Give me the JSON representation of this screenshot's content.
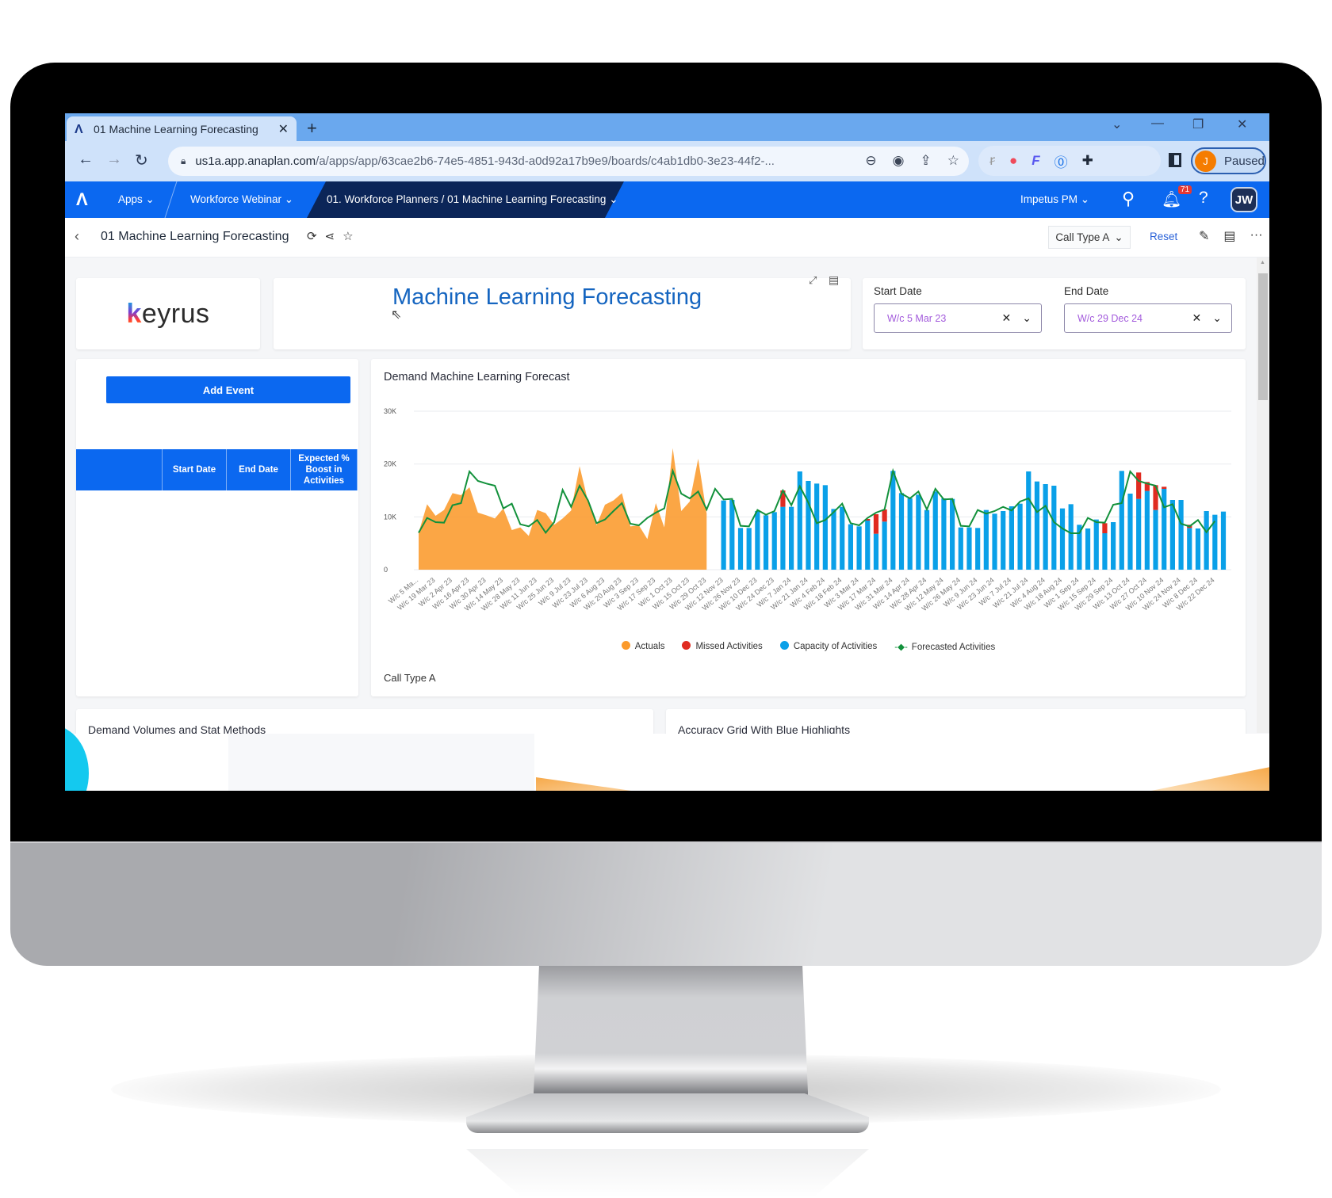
{
  "browser": {
    "tab_title": "01 Machine Learning Forecasting",
    "url_host": "us1a.app.anaplan.com",
    "url_path": "/a/apps/app/63cae2b6-74e5-4851-943d-a0d92a17b9e9/boards/c4ab1db0-3e23-44f2-...",
    "profile_initial": "J",
    "profile_status": "Paused"
  },
  "appbar": {
    "apps_label": "Apps",
    "workspace_label": "Workforce Webinar",
    "page_breadcrumb": "01. Workforce Planners / 01 Machine Learning Forecasting",
    "workspace_model": "Impetus PM",
    "notification_count": "71",
    "user_initials": "JW"
  },
  "pagebar": {
    "title": "01 Machine Learning Forecasting",
    "context_selector": "Call Type A",
    "reset_label": "Reset"
  },
  "header_card": {
    "logo_text": "keyrus",
    "logo_first_letter": "k",
    "logo_rest": "eyrus",
    "title": "Machine Learning Forecasting"
  },
  "filters": {
    "start_label": "Start Date",
    "start_value": "W/c 5 Mar 23",
    "end_label": "End Date",
    "end_value": "W/c 29 Dec 24"
  },
  "events": {
    "add_button": "Add Event",
    "columns": [
      "",
      "Start Date",
      "End Date",
      "Expected % Boost in Activities"
    ]
  },
  "sections": {
    "demand_volumes": "Demand Volumes and Stat Methods",
    "accuracy_grid": "Accuracy Grid With Blue Highlights"
  },
  "colors": {
    "actuals": "#fb9a2b",
    "missed": "#e02b20",
    "capacity": "#0aa0e8",
    "forecast": "#12913b",
    "brand": "#0b68f0"
  },
  "chart_data": {
    "type": "bar",
    "title": "Demand Machine Learning Forecast",
    "subtitle": "Call Type A",
    "xlabel": "",
    "ylabel": "",
    "ylim": [
      0,
      30000
    ],
    "yticks": [
      "0",
      "10K",
      "20K",
      "30K"
    ],
    "grid": true,
    "legend_position": "bottom",
    "legend": [
      "Actuals",
      "Missed Activities",
      "Capacity of Activities",
      "Forecasted Activities"
    ],
    "week_count": 96,
    "x_tick_labels": [
      "W/c 5 Ma...",
      "W/c 19 Mar 23",
      "W/c 2 Apr 23",
      "W/c 16 Apr 23",
      "W/c 30 Apr 23",
      "W/c 14 May 23",
      "W/c 28 May 23",
      "W/c 11 Jun 23",
      "W/c 25 Jun 23",
      "W/c 9 Jul 23",
      "W/c 23 Jul 23",
      "W/c 6 Aug 23",
      "W/c 20 Aug 23",
      "W/c 3 Sep 23",
      "W/c 17 Sep 23",
      "W/c 1 Oct 23",
      "W/c 15 Oct 23",
      "W/c 29 Oct 23",
      "W/c 12 Nov 23",
      "W/c 26 Nov 23",
      "W/c 10 Dec 23",
      "W/c 24 Dec 23",
      "W/c 7 Jan 24",
      "W/c 21 Jan 24",
      "W/c 4 Feb 24",
      "W/c 18 Feb 24",
      "W/c 3 Mar 24",
      "W/c 17 Mar 24",
      "W/c 31 Mar 24",
      "W/c 14 Apr 24",
      "W/c 28 Apr 24",
      "W/c 12 May 24",
      "W/c 26 May 24",
      "W/c 9 Jun 24",
      "W/c 23 Jun 24",
      "W/c 7 Jul 24",
      "W/c 21 Jul 24",
      "W/c 4 Aug 24",
      "W/c 18 Aug 24",
      "W/c 1 Sep 24",
      "W/c 15 Sep 24",
      "W/c 29 Sep 24",
      "W/c 13 Oct 24",
      "W/c 27 Oct 24",
      "W/c 10 Nov 24",
      "W/c 24 Nov 24",
      "W/c 8 Dec 24",
      "W/c 22 Dec 24"
    ],
    "series": [
      {
        "name": "Actuals",
        "kind": "area",
        "start_index": 0,
        "values": [
          7000,
          12400,
          10200,
          11300,
          14500,
          14100,
          15600,
          10800,
          10300,
          9700,
          11600,
          7500,
          8000,
          6400,
          11300,
          10700,
          8500,
          9700,
          11200,
          19600,
          12900,
          8400,
          12300,
          13100,
          14500,
          8200,
          8400,
          5800,
          12600,
          8000,
          23000,
          11100,
          12900,
          21000,
          10600
        ]
      },
      {
        "name": "Capacity of Activities",
        "kind": "bar",
        "start_index": 36,
        "values": [
          13100,
          13200,
          7900,
          7900,
          11100,
          10300,
          10900,
          11900,
          11900,
          18600,
          16800,
          16300,
          16000,
          11500,
          11900,
          8600,
          8200,
          9300,
          6800,
          9100,
          18700,
          14500,
          13500,
          14200,
          11300,
          14800,
          13500,
          13400,
          8000,
          8000,
          7900,
          11300,
          10600,
          11100,
          12000,
          12500,
          18600,
          16700,
          16200,
          15900,
          11600,
          12400,
          8500,
          7800,
          9500,
          6900,
          9000,
          18700,
          14400,
          13400,
          14900,
          11300,
          15300,
          13200,
          13200,
          7900,
          7800,
          11100,
          10400,
          11000
        ]
      },
      {
        "name": "Missed Activities",
        "kind": "stacked-bar",
        "start_index": 36,
        "values": [
          0,
          0,
          0,
          0,
          0,
          0,
          0,
          3100,
          0,
          0,
          0,
          0,
          0,
          0,
          0,
          0,
          0,
          300,
          3700,
          2300,
          0,
          0,
          0,
          0,
          0,
          0,
          0,
          0,
          0,
          0,
          0,
          0,
          0,
          0,
          0,
          0,
          0,
          0,
          0,
          0,
          0,
          0,
          0,
          0,
          0,
          1900,
          0,
          0,
          0,
          5000,
          1700,
          4700,
          400,
          0,
          0,
          600,
          0,
          0,
          0,
          0
        ]
      },
      {
        "name": "Forecasted Activities",
        "kind": "line",
        "start_index": 0,
        "values": [
          7000,
          9800,
          9000,
          8900,
          12200,
          12600,
          18600,
          16800,
          16300,
          15900,
          11600,
          12500,
          8600,
          8200,
          9400,
          7000,
          9000,
          15100,
          11900,
          15900,
          13100,
          8800,
          9500,
          11100,
          12600,
          8700,
          8400,
          9800,
          10800,
          11600,
          18700,
          14400,
          13500,
          14800,
          11400,
          15300,
          13300,
          13400,
          8300,
          8200,
          11300,
          10400,
          11100,
          15000,
          12200,
          15800,
          12700,
          8800,
          9400,
          10900,
          12500,
          8800,
          8400,
          9800,
          10800,
          11400,
          18700,
          14400,
          13500,
          14800,
          11400,
          15300,
          13300,
          13400,
          8300,
          8200,
          11300,
          10600,
          11100,
          11900,
          11200,
          12900,
          13500,
          10900,
          12100,
          9000,
          7800,
          6900,
          6900,
          9800,
          9000,
          8900,
          12300,
          12600,
          18600,
          16800,
          16300,
          15900,
          11800,
          12400,
          8700,
          8200,
          9400,
          7100,
          9200
        ]
      }
    ]
  }
}
